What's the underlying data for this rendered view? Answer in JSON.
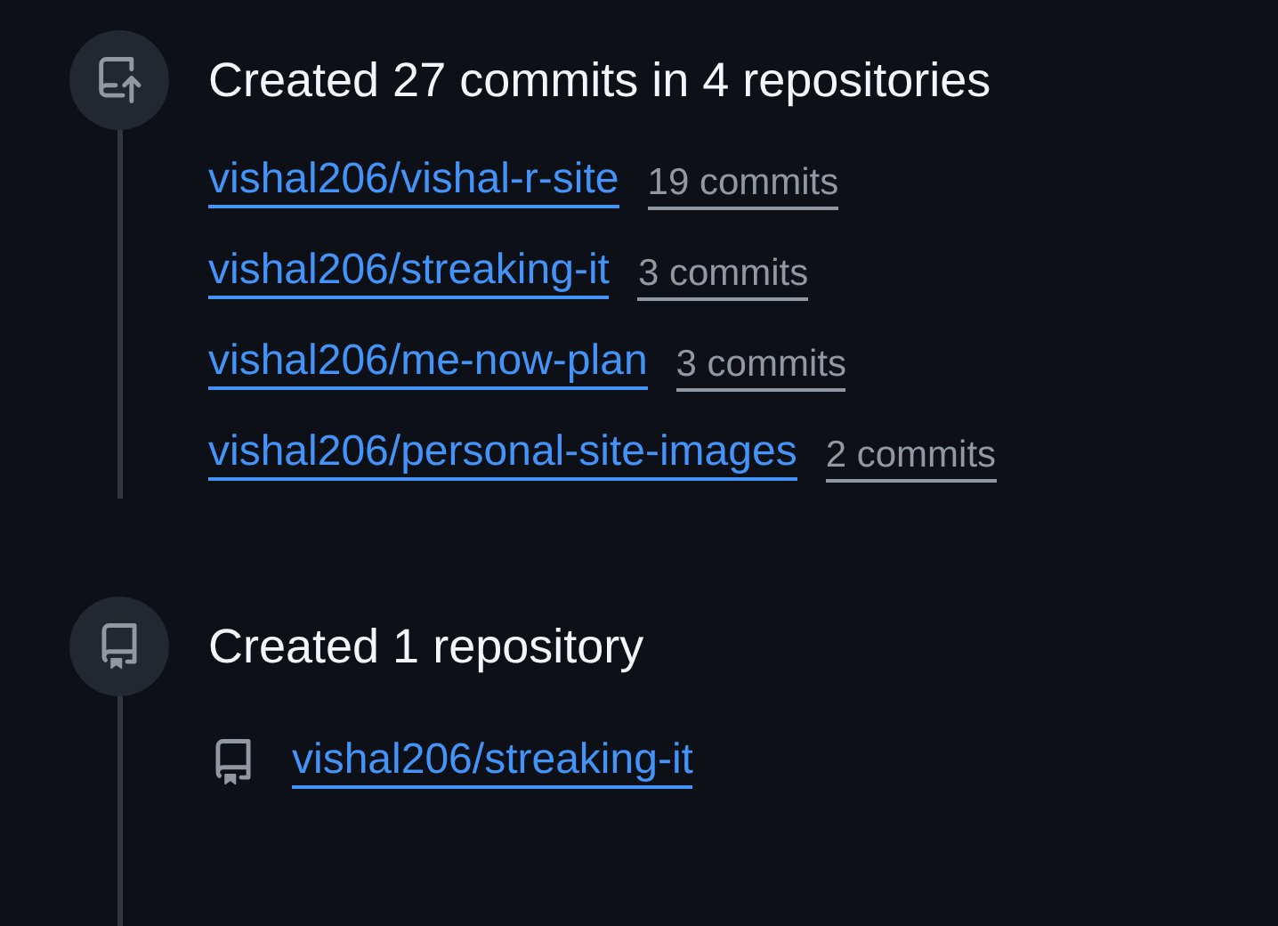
{
  "events": [
    {
      "kind": "commits",
      "title": "Created 27 commits in 4 repositories",
      "items": [
        {
          "repo": "vishal206/vishal-r-site",
          "count": "19 commits"
        },
        {
          "repo": "vishal206/streaking-it",
          "count": "3 commits"
        },
        {
          "repo": "vishal206/me-now-plan",
          "count": "3 commits"
        },
        {
          "repo": "vishal206/personal-site-images",
          "count": "2 commits"
        }
      ]
    },
    {
      "kind": "repository",
      "title": "Created 1 repository",
      "items": [
        {
          "repo": "vishal206/streaking-it"
        }
      ]
    }
  ]
}
